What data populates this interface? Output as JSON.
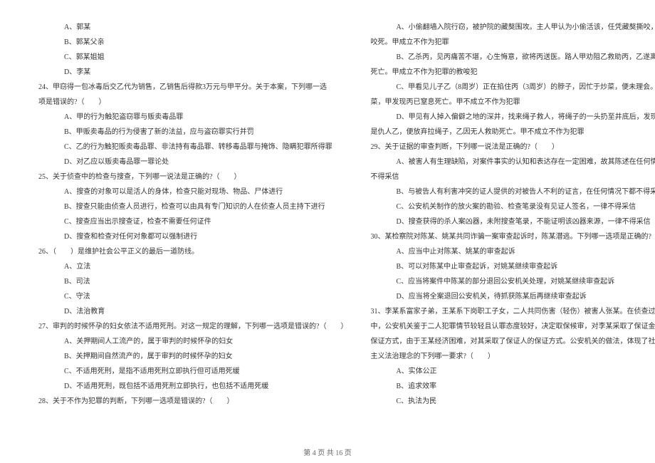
{
  "left": {
    "opts_top": [
      "A、郭某",
      "B、郭某父亲",
      "C、郭某姐姐",
      "D、李某"
    ],
    "q24": "24、甲窃得一包冰毒后交乙代为销售，乙销售后得款3万元与甲平分。关于本案，下列哪一选",
    "q24_cont": "项是错误的?（　　）",
    "q24_opts": [
      "A、甲的行为触犯盗窃罪与贩卖毒品罪",
      "B、甲贩卖毒品的行为侵害了新的法益，应与盗窃罪实行并罚",
      "C、乙的行为触犯贩卖毒品罪、非法持有毒品罪、转移毒品罪与掩饰、隐瞒犯罪所得罪",
      "D、对乙应以贩卖毒品罪一罪论处"
    ],
    "q25": "25、关于侦查中的检查与搜查，下列哪一说法是正确的?（　　）",
    "q25_opts": [
      "A、搜查的对象可以是活人的身体，检查只能对现场、物品、尸体进行",
      "B、搜查只能由侦查人员进行，检查可以由具有专门知识的人在侦查人员主持下进行",
      "C、搜查应当出示搜查证，检查不需要任何证件",
      "D、搜查和检查对任何对象都可以强制进行"
    ],
    "q26": "26、（　　）是维护社会公平正义的最后一道防线。",
    "q26_opts": [
      "A、立法",
      "B、司法",
      "C、守法",
      "D、法治教育"
    ],
    "q27": "27、审判的时候怀孕的妇女依法不适用死刑。对这一规定的理解，下列哪一选项是错误的?（　　）",
    "q27_opts": [
      "A、关押期间人工流产的，属于审判的时候怀孕的妇女",
      "B、关押期间自然流产的，属于审判的时候怀孕的妇女",
      "C、不适用死刑，是指不适用死刑立即执行但可适用死缓",
      "D、不适用死刑，既包括不适用死刑立即执行，也包括不适用死缓"
    ],
    "q28": "28、关于不作为犯罪的判断，下列哪一选项是错误的?（　　）"
  },
  "right": {
    "q28_opts": [
      "A、小偷翻墙入院行窃，被护院的藏獒围攻。主人甲认为小偷活该，任凭藏獒撕咬，小偷被",
      "B、乙杀丙，见丙痛苦不堪，心生悔意，欲将丙送医。路人甲劝阻乙救助丙，乙遂离开，丙",
      "C、甲看见儿子乙（8周岁）正在掐住丙（3周岁）的脖子，因忙于炒菜，便未理会。等炒完",
      "D、甲见有人掉入偏僻之地的深井，找来绳子救人，将绳子的一头扔至井底后，发现井下的"
    ],
    "q28_cont": [
      "咬死。甲成立不作为犯罪",
      "死亡。甲成立不作为犯罪的教唆犯",
      "菜，甲发现丙已窒息死亡。甲不成立不作为犯罪",
      "是仇人乙，便放弃拉绳子，乙因无人救助死亡。甲不成立不作为犯罪"
    ],
    "q29": "29、关于证据的审查判断，下列哪一说法是正确的?（　　）",
    "q29_opts": [
      "A、被害人有生理缺陷，对案件事实的认知和表达存在一定困难，故其陈述在任何情况下都",
      "B、与被告人有利害冲突的证人提供的对被告人不利的证言，在任何情况下都不得采信",
      "C、公安机关制作的放火案的勘验、检查笔录没有见证人签名，一律不得采信",
      "D、搜查获得的杀人案凶器，未附搜查笔录，不能证明该凶器来源，一律不得采信"
    ],
    "q29_cont": "不得采信",
    "q30": "30、某检察院对陈某、姚某共同诈骗一案审查起诉时，陈某潜逃。下列哪一选项是正确的?（　　）",
    "q30_opts": [
      "A、应当中止对陈某、姚某的审查起诉",
      "B、可以对陈某中止审查起诉，对姚某继续审查起诉",
      "C、应当将案件中陈某的部分退回公安机关处理，对姚某继续审查起诉",
      "D、应当将全案退回公安机关，待抓获陈某后再继续审查起诉"
    ],
    "q31": "31、李某系富家子弟，王某系下岗职工子女，二人共同伤害（轻伤）被害人张某。在侦查过程",
    "q31_cont1": "中，公安机关鉴于二人犯罪情节较轻且认罪态度较好，决定取保候审，对李某采取了保证金的",
    "q31_cont2": "保证方式，由于王某经济困难，对其采取了保证人的保证方式。公安机关的做法，体现了社会",
    "q31_cont3": "主义法治理念的下列哪一要求?（　　）",
    "q31_opts": [
      "A、实体公正",
      "B、追求效率",
      "C、执法为民"
    ]
  },
  "footer": "第 4 页 共 16 页"
}
